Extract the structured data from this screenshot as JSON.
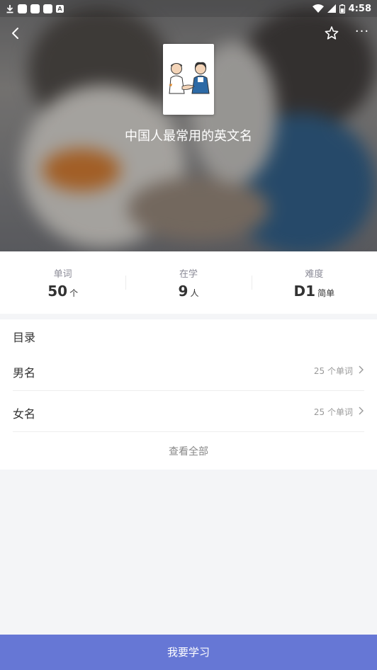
{
  "status_bar": {
    "time": "4:58",
    "icons": [
      "download-icon",
      "notification-icon",
      "notification-icon",
      "notification-icon",
      "a-icon",
      "wifi-icon",
      "signal-icon",
      "battery-icon"
    ]
  },
  "header": {
    "book_title": "中国人最常用的英文名",
    "more_label": "···",
    "icons": [
      "back-arrow-icon",
      "star-icon",
      "more-icon"
    ]
  },
  "stats": [
    {
      "label": "单词",
      "value": "50",
      "unit": "个"
    },
    {
      "label": "在学",
      "value": "9",
      "unit": "人"
    },
    {
      "label": "难度",
      "value": "D1",
      "unit": "简单"
    }
  ],
  "catalog": {
    "title": "目录",
    "items": [
      {
        "name": "男名",
        "count": "25 个单词"
      },
      {
        "name": "女名",
        "count": "25 个单词"
      }
    ],
    "view_all": "查看全部"
  },
  "footer": {
    "study_button": "我要学习"
  },
  "colors": {
    "accent": "#6677d5",
    "background": "#f4f5f7"
  }
}
